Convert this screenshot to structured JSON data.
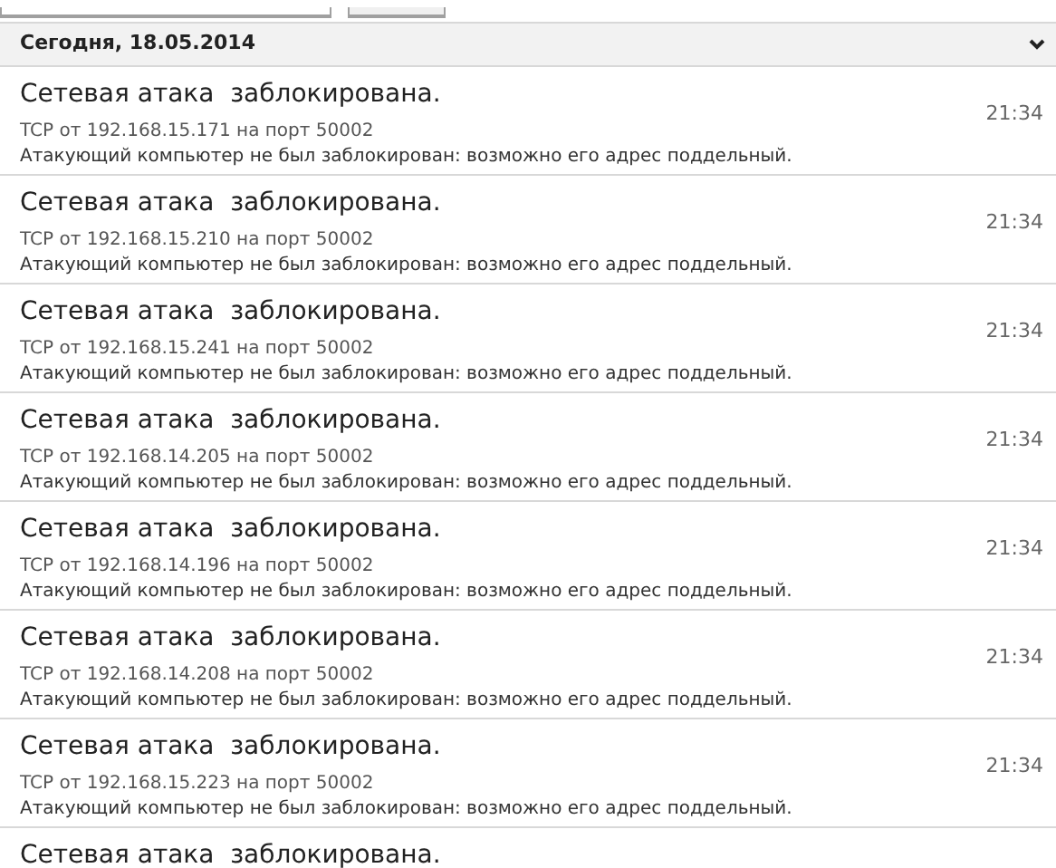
{
  "group": {
    "title": "Сегодня, 18.05.2014",
    "expanded": true
  },
  "events": [
    {
      "title": "Сетевая атака  заблокирована.",
      "detail": "TCP от 192.168.15.171 на порт 50002",
      "description": "Атакующий компьютер не был заблокирован: возможно его адрес поддельный.",
      "time": "21:34"
    },
    {
      "title": "Сетевая атака  заблокирована.",
      "detail": "TCP от 192.168.15.210 на порт 50002",
      "description": "Атакующий компьютер не был заблокирован: возможно его адрес поддельный.",
      "time": "21:34"
    },
    {
      "title": "Сетевая атака  заблокирована.",
      "detail": "TCP от 192.168.15.241 на порт 50002",
      "description": "Атакующий компьютер не был заблокирован: возможно его адрес поддельный.",
      "time": "21:34"
    },
    {
      "title": "Сетевая атака  заблокирована.",
      "detail": "TCP от 192.168.14.205 на порт 50002",
      "description": "Атакующий компьютер не был заблокирован: возможно его адрес поддельный.",
      "time": "21:34"
    },
    {
      "title": "Сетевая атака  заблокирована.",
      "detail": "TCP от 192.168.14.196 на порт 50002",
      "description": "Атакующий компьютер не был заблокирован: возможно его адрес поддельный.",
      "time": "21:34"
    },
    {
      "title": "Сетевая атака  заблокирована.",
      "detail": "TCP от 192.168.14.208 на порт 50002",
      "description": "Атакующий компьютер не был заблокирован: возможно его адрес поддельный.",
      "time": "21:34"
    },
    {
      "title": "Сетевая атака  заблокирована.",
      "detail": "TCP от 192.168.15.223 на порт 50002",
      "description": "Атакующий компьютер не был заблокирован: возможно его адрес поддельный.",
      "time": "21:34"
    },
    {
      "title": "Сетевая атака  заблокирована."
    }
  ]
}
